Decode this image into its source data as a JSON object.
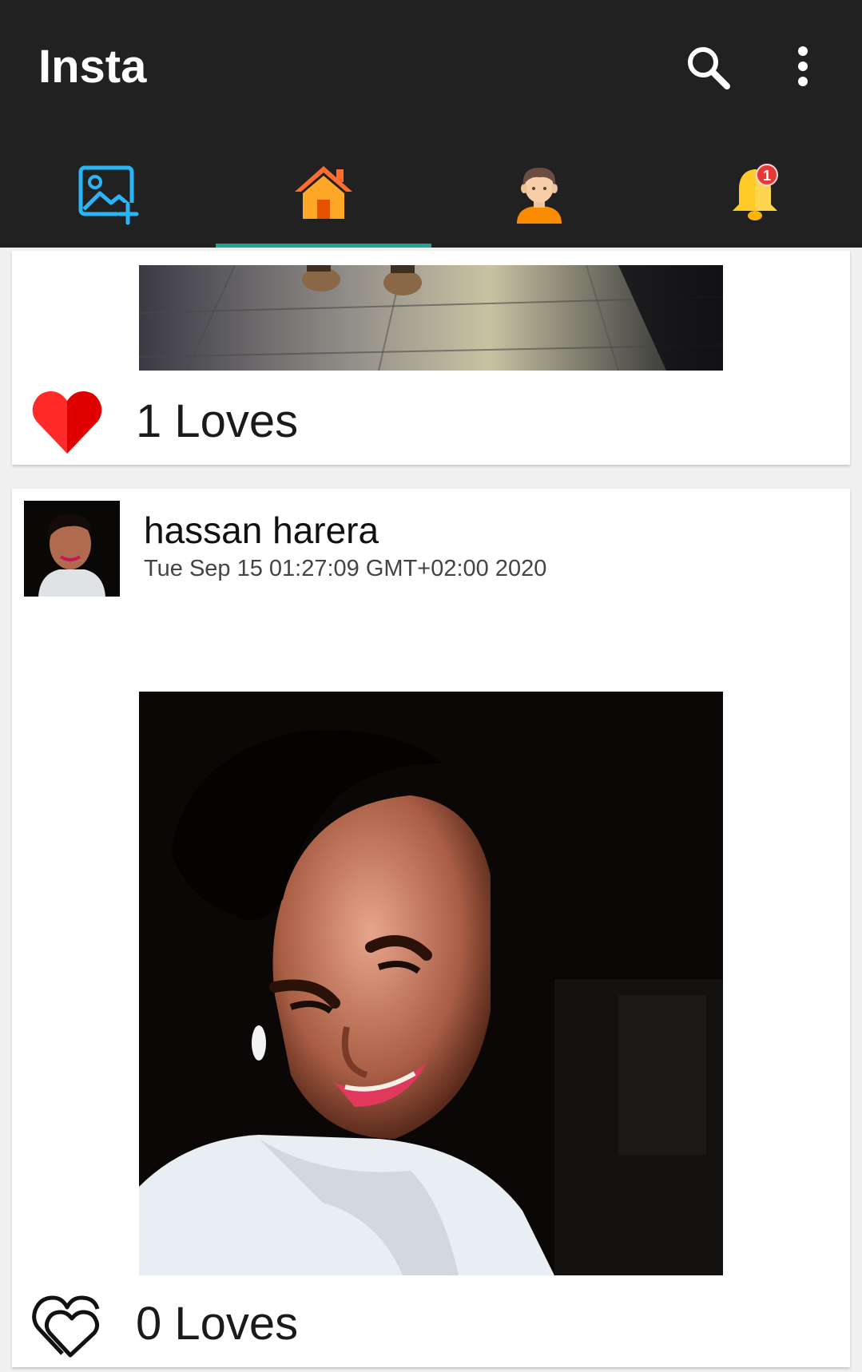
{
  "app": {
    "title": "Insta",
    "accent_color": "#1ea398",
    "appbar_color": "#212121"
  },
  "toolbar": {
    "actions": [
      {
        "name": "search",
        "icon": "search-icon"
      },
      {
        "name": "more-options",
        "icon": "more-vertical-icon"
      }
    ]
  },
  "tabs": [
    {
      "name": "add-photo",
      "icon": "add-photo-icon",
      "selected": false
    },
    {
      "name": "home",
      "icon": "home-icon",
      "selected": true
    },
    {
      "name": "profile",
      "icon": "profile-icon",
      "selected": false
    },
    {
      "name": "notifications",
      "icon": "bell-icon",
      "selected": false,
      "badge": "1"
    }
  ],
  "posts": [
    {
      "image": "photo-feet-on-tiled-floor",
      "loved": true,
      "loves_label": "1 Loves"
    },
    {
      "username": "hassan harera",
      "timestamp": "Tue Sep 15 01:27:09 GMT+02:00 2020",
      "avatar": "user-avatar-photo",
      "image": "photo-selfie",
      "loved": false,
      "loves_label": "0 Loves"
    }
  ]
}
